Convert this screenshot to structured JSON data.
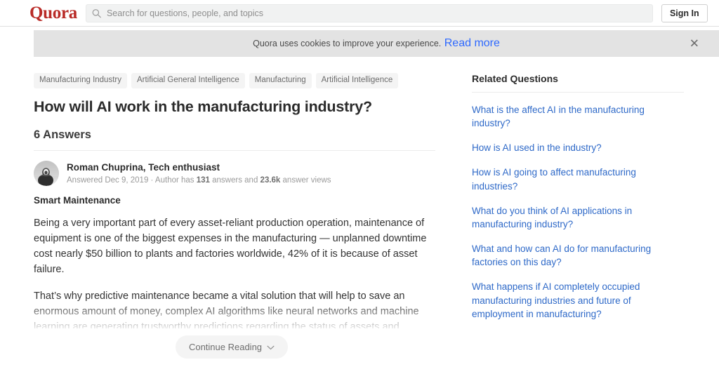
{
  "header": {
    "logo_text": "Quora",
    "logo_color": "#b92b27",
    "search": {
      "placeholder": "Search for questions, people, and topics",
      "value": "",
      "icon": "search-icon"
    },
    "sign_in_label": "Sign In"
  },
  "cookie_banner": {
    "message": "Quora uses cookies to improve your experience.",
    "link_label": "Read more",
    "close_icon": "✕",
    "background": "#e3e3e3",
    "link_color": "#2e69ff"
  },
  "main": {
    "tags": [
      {
        "label": "Manufacturing Industry"
      },
      {
        "label": "Artificial General Intelligence"
      },
      {
        "label": "Manufacturing"
      },
      {
        "label": "Artificial Intelligence"
      }
    ],
    "question_title": "How will AI work in the manufacturing industry?",
    "answer_count_label": "6 Answers",
    "answer": {
      "author_name": "Roman Chuprina, Tech enthusiast",
      "answered_prefix": "Answered Dec 9, 2019 · Author has ",
      "answers_count": "131",
      "answers_mid": " answers and ",
      "views_count": "23.6k",
      "views_suffix": " answer views",
      "heading": "Smart Maintenance",
      "paragraph_1": "Being a very important part of every asset-reliant production operation, maintenance of equipment is one of the biggest expenses in the manufacturing — unplanned downtime cost nearly $50 billion to plants and factories worldwide, 42% of it is because of asset failure.",
      "paragraph_2": "That’s why predictive maintenance became a vital solution that will help to save an enormous amount of money, complex AI algorithms like neural networks and machine learning are generating trustworthy predictions regarding the status of assets and equipment in the manufacturing field."
    },
    "continue_reading_label": "Continue Reading",
    "continue_reading_icon": "chevron-down-icon"
  },
  "sidebar": {
    "title": "Related Questions",
    "link_color": "#2e69c8",
    "questions": [
      {
        "label": "What is the affect AI in the manufacturing industry?"
      },
      {
        "label": "How is AI used in the industry?"
      },
      {
        "label": "How is AI going to affect manufacturing industries?"
      },
      {
        "label": "What do you think of AI applications in manufacturing industry?"
      },
      {
        "label": "What and how can AI do for manufacturing factories on this day?"
      },
      {
        "label": "What happens if AI completely occupied manufacturing industries and future of employment in manufacturing?"
      }
    ]
  }
}
